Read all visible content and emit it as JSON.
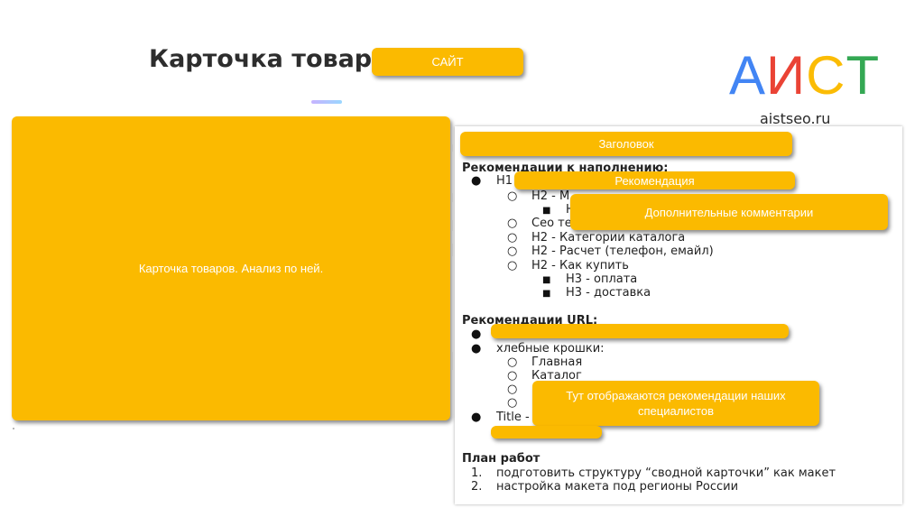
{
  "header": {
    "title": "Карточка товара",
    "site_button": "САЙТ"
  },
  "logo": {
    "letters": [
      {
        "char": "А",
        "color": "#4285f4"
      },
      {
        "char": "И",
        "color": "#ea4335"
      },
      {
        "char": "С",
        "color": "#fbbc05"
      },
      {
        "char": "Т",
        "color": "#34a853"
      }
    ],
    "url": "aistseo.ru"
  },
  "left_card": {
    "text": "Карточка товаров. Анализ по ней."
  },
  "annotations": {
    "header": "Заголовок",
    "recommendation": "Рекомендация",
    "comments": "Дополнительные комментарии",
    "specialists": "Тут отображаются рекомендации наших специалистов"
  },
  "doc": {
    "section_content": "Рекомендации к наполнению:",
    "h1": "H1",
    "h2_cut": "H2 - М",
    "seo": "Сео те",
    "h2_catalog": "H2 - Категории каталога",
    "h2_calc": "H2 - Расчет (телефон, емайл)",
    "h2_buy": "H2 - Как купить",
    "h3_pay": "H3 - оплата",
    "h3_delivery": "H3 - доставка",
    "section_url": "Рекомендации URL:",
    "breadcrumbs": "хлебные крошки:",
    "crumb_main": "Главная",
    "crumb_catalog": "Каталог",
    "title_cut": "Title -",
    "section_plan": "План работ",
    "plan": [
      {
        "num": "1.",
        "text": "подготовить структуру “сводной карточки” как макет"
      },
      {
        "num": "2.",
        "text": "настройка макета под регионы России"
      }
    ]
  },
  "colors": {
    "accent_yellow": "#fbba00",
    "title_text": "#2d2d2d"
  }
}
